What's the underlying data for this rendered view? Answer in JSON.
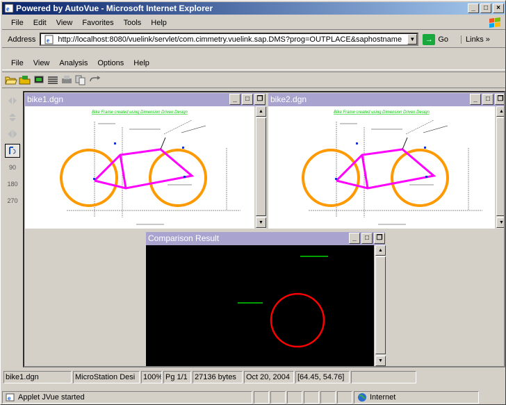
{
  "window": {
    "title": "Powered by AutoVue - Microsoft Internet Explorer"
  },
  "ie_menu": [
    "File",
    "Edit",
    "View",
    "Favorites",
    "Tools",
    "Help"
  ],
  "address": {
    "label": "Address",
    "url": "http://localhost:8080/vuelink/servlet/com.cimmetry.vuelink.sap.DMS?prog=OUTPLACE&saphostname",
    "go_label": "Go",
    "links_label": "Links"
  },
  "app_menu": [
    "File",
    "View",
    "Analysis",
    "Options",
    "Help"
  ],
  "toolbar_icons": [
    "open-folder-icon",
    "save-icon",
    "monitor-icon",
    "layers-icon",
    "print-icon",
    "compare-icon",
    "link-icon"
  ],
  "left_tools": [
    "mirror-horizontal-icon",
    "mirror-vertical-icon",
    "mirror-both-icon",
    "rotate-0-icon",
    "rotate-90-icon",
    "rotate-180-icon",
    "rotate-270-icon"
  ],
  "left_tool_labels": [
    "",
    "",
    "",
    "",
    "90",
    "180",
    "270"
  ],
  "documents": [
    {
      "title": "bike1.dgn",
      "caption": "Bike Frame created using Dimension Driven Design"
    },
    {
      "title": "bike2.dgn",
      "caption": "Bike Frame created using Dimension Driven Design"
    }
  ],
  "comparison": {
    "title": "Comparison Result"
  },
  "app_status": {
    "file": "bike1.dgn",
    "format": "MicroStation Desi",
    "zoom": "100%",
    "page": "Pg 1/1",
    "size": "27136 bytes",
    "date": "Oct 20, 2004",
    "coords": "[64.45, 54.76]"
  },
  "ie_status": {
    "message": "Applet JVue started",
    "zone": "Internet"
  },
  "colors": {
    "frame": "#ff00ff",
    "wheel": "#ff9900",
    "diff_circle": "#ff0000",
    "diff_text": "#00ff00",
    "caption": "#00cc00"
  }
}
